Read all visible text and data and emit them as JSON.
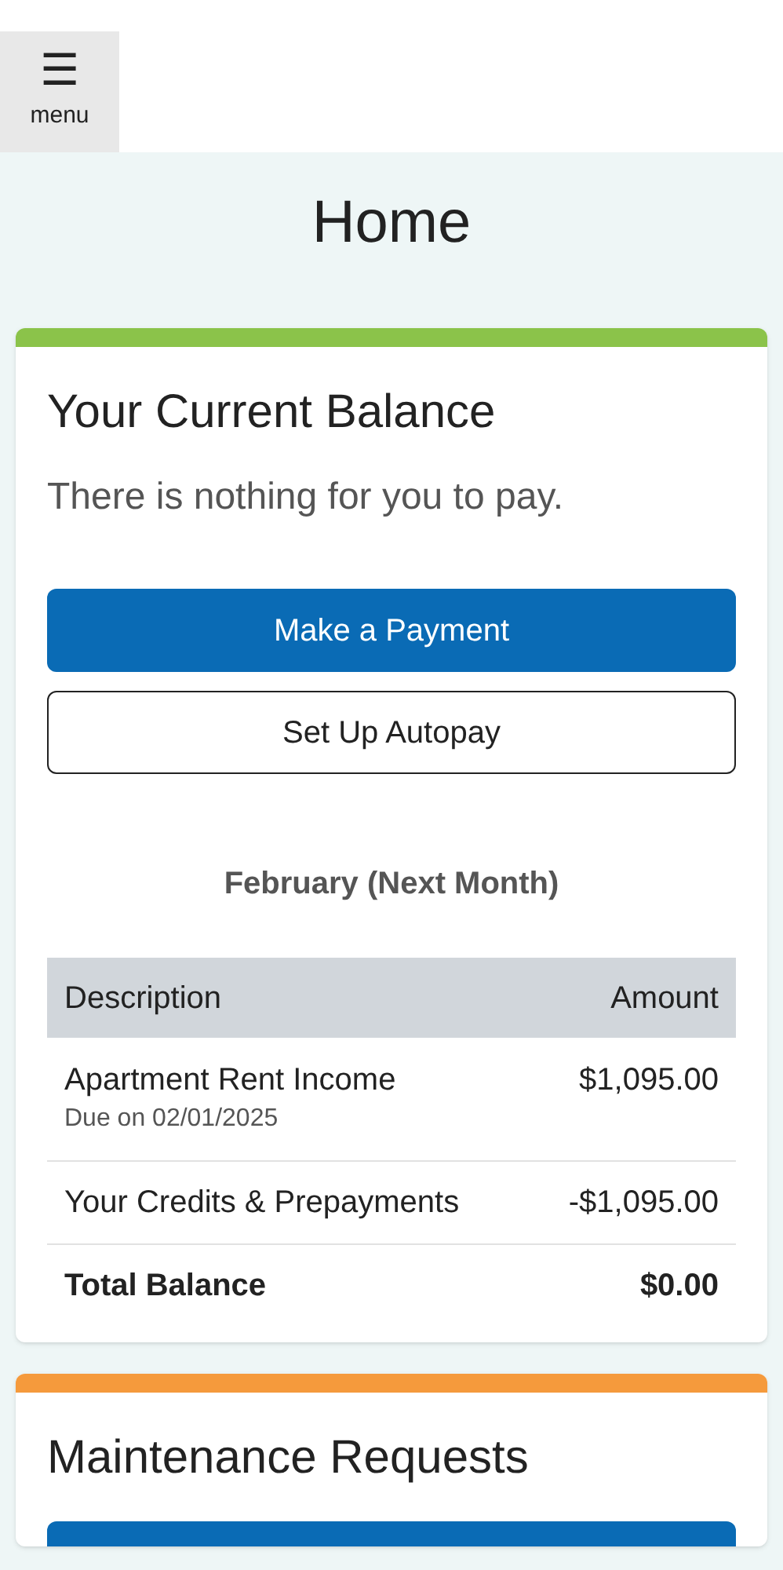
{
  "header": {
    "menu_button": {
      "label": "☰",
      "caption": "menu"
    }
  },
  "page": {
    "title": "Home"
  },
  "balance_card": {
    "title": "Your Current Balance",
    "message": "There is nothing for you to pay.",
    "buttons": [
      {
        "label": "Make a Payment",
        "kind": "primary"
      },
      {
        "label": "Set Up Autopay",
        "kind": "outline"
      }
    ],
    "period": "February (Next Month)",
    "table": {
      "columns": [
        "Description",
        "Amount"
      ],
      "rows": [
        {
          "description": "Apartment Rent Income",
          "note": "Due on 02/01/2025",
          "amount": "$1,095.00",
          "kind": "item"
        },
        {
          "description": "Your Credits & Prepayments",
          "amount": "-$1,095.00",
          "kind": "item"
        },
        {
          "description": "Total Balance",
          "amount": "$0.00",
          "kind": "total"
        }
      ]
    }
  },
  "maintenance_card": {
    "title": "Maintenance Requests"
  }
}
